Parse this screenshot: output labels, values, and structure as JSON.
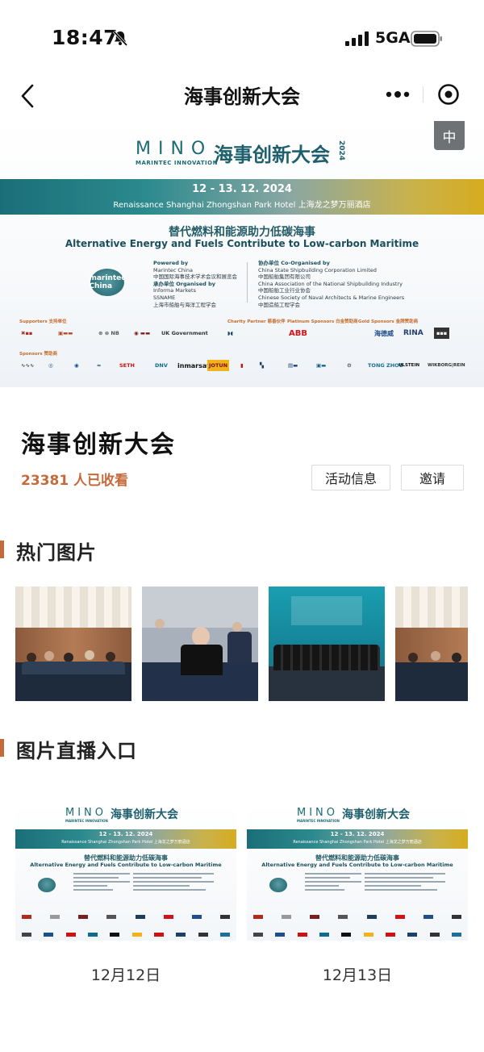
{
  "status_bar": {
    "time": "18:47",
    "network": "5GA"
  },
  "nav": {
    "title": "海事创新大会"
  },
  "banner": {
    "logo_word": "MINO",
    "logo_sub": "MARINTEC INNOVATION",
    "title": "海事创新大会",
    "year": "2024",
    "dates": "12 - 13. 12. 2024",
    "venue": "Renaissance Shanghai Zhongshan Park Hotel 上海龙之梦万丽酒店",
    "theme_cn": "替代燃料和能源助力低碳海事",
    "theme_en": "Alternative Energy and Fuels Contribute to Low-carbon Maritime",
    "logo_badge": "marintec China",
    "powered_by_label": "Powered by",
    "powered_by": "Marintec China",
    "powered_by_cn": "中国国际海事技术学术会议和展览会",
    "organised_label": "承办单位 Organised by",
    "organised_1": "Informa Markets",
    "organised_2": "SSNAME",
    "organised_3": "上海市船舶与海洋工程学会",
    "coorg_label": "协办单位 Co-Organised by",
    "coorg_1": "China State Shipbuilding Corporation Limited",
    "coorg_1_cn": "中国船舶集团有限公司",
    "coorg_2": "China Association of the National Shipbuilding Industry",
    "coorg_2_cn": "中国船舶工业行业协会",
    "coorg_3": "Chinese Society of Naval Architects & Marine Engineers",
    "coorg_3_cn": "中国造船工程学会",
    "sponsor_labels": [
      "Supporters 支持单位",
      "Charity Partner 慈善伙伴",
      "Platinum Sponsors 白金赞助商",
      "Gold Sponsors 金牌赞助商"
    ],
    "sponsors_row1": [
      "UK Government",
      "ABB",
      "RINA",
      "海德威"
    ],
    "sponsors_row2": [
      "SETH",
      "DNV",
      "inmarsat",
      "JOTUN",
      "MAERSK",
      "TONG ZHOU",
      "ULSTEIN",
      "WIKBORG|REIN"
    ]
  },
  "language_badge": "中",
  "event": {
    "name": "海事创新大会",
    "views": "23381 人已收看",
    "activity_button": "活动信息",
    "invite_button": "邀请"
  },
  "sections": {
    "hot_photos": "热门图片",
    "live_entry": "图片直播入口"
  },
  "live_entries": [
    {
      "date": "12月12日"
    },
    {
      "date": "12月13日"
    }
  ],
  "colors": {
    "accent": "#c56a3a",
    "teal": "#1d5f6c",
    "gold": "#d6ac1f"
  }
}
